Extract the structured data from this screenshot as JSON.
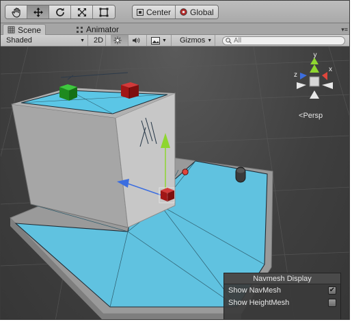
{
  "toolbar": {
    "pivot_center_label": "Center",
    "pivot_global_label": "Global"
  },
  "tabs": [
    {
      "label": "Scene"
    },
    {
      "label": "Animator"
    }
  ],
  "scene_bar": {
    "shading_mode": "Shaded",
    "mode_2d": "2D",
    "gizmos_label": "Gizmos",
    "search_placeholder": "All"
  },
  "gizmo": {
    "axis_x": "x",
    "axis_y": "y",
    "axis_z": "z",
    "projection_label": "Persp"
  },
  "navmesh_panel": {
    "title": "Navmesh Display",
    "options": [
      {
        "label": "Show NavMesh",
        "checked": true
      },
      {
        "label": "Show HeightMesh",
        "checked": false
      }
    ]
  },
  "colors": {
    "navmesh": "#5bc6e6",
    "ground": "#9c9c9c",
    "axis_x": "#e0463c",
    "axis_y": "#8ed630",
    "axis_z": "#3c6ee0",
    "cube_red": "#a11616",
    "cube_green": "#1e8a1e"
  }
}
